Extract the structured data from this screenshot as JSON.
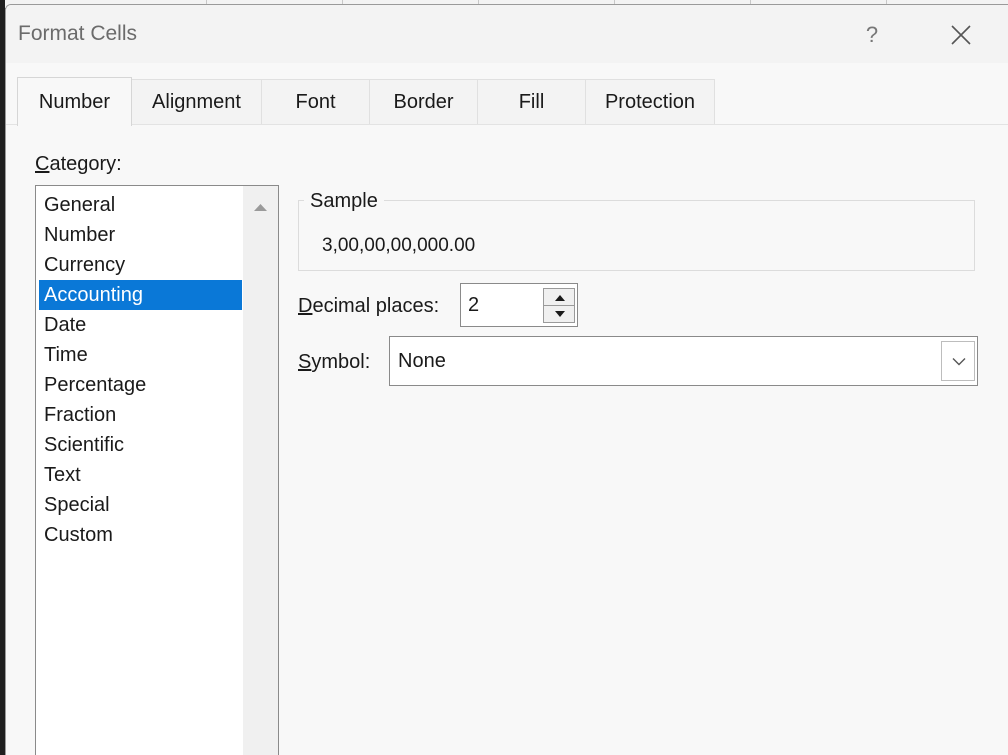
{
  "dialog": {
    "title": "Format Cells",
    "help_label": "?"
  },
  "tabs": [
    {
      "label": "Number"
    },
    {
      "label": "Alignment"
    },
    {
      "label": "Font"
    },
    {
      "label": "Border"
    },
    {
      "label": "Fill"
    },
    {
      "label": "Protection"
    }
  ],
  "active_tab": "Number",
  "category": {
    "label_accel": "C",
    "label_rest": "ategory:",
    "items": [
      "General",
      "Number",
      "Currency",
      "Accounting",
      "Date",
      "Time",
      "Percentage",
      "Fraction",
      "Scientific",
      "Text",
      "Special",
      "Custom"
    ],
    "selected": "Accounting"
  },
  "sample": {
    "title": "Sample",
    "value": "3,00,00,00,000.00"
  },
  "decimal_places": {
    "label_accel": "D",
    "label_rest": "ecimal places:",
    "value": "2"
  },
  "symbol": {
    "label_accel": "S",
    "label_rest": "ymbol:",
    "value": "None"
  },
  "icons": {
    "close": "close-icon",
    "spin_up": "triangle-up-icon",
    "spin_down": "triangle-down-icon",
    "dropdown": "chevron-down-icon",
    "scroll_up": "scroll-up-arrow-icon"
  },
  "colors": {
    "selection": "#0a78d7",
    "dialog_bg": "#f8f8f8",
    "title_text": "#6b6b6b"
  }
}
